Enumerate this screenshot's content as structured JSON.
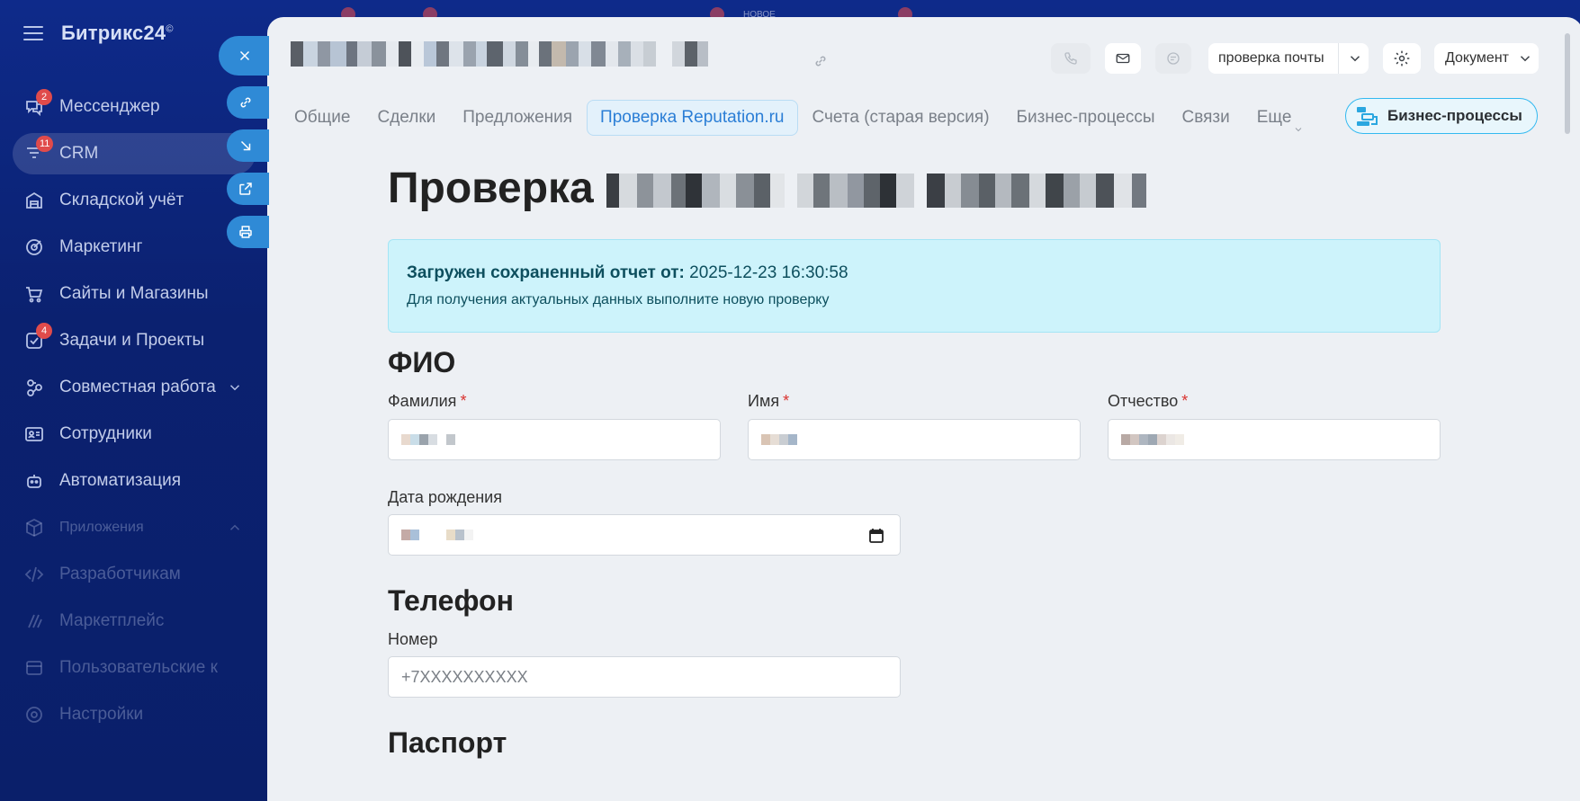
{
  "sidebar": {
    "logo": "Битрикс24",
    "logo_mark": "©",
    "items": [
      {
        "label": "Мессенджер",
        "badge": "2",
        "icon": "messenger-icon"
      },
      {
        "label": "CRM",
        "badge": "11",
        "icon": "crm-funnel-icon"
      },
      {
        "label": "Складской учёт",
        "badge": "",
        "icon": "warehouse-icon"
      },
      {
        "label": "Маркетинг",
        "badge": "",
        "icon": "marketing-icon"
      },
      {
        "label": "Сайты и Магазины",
        "badge": "",
        "icon": "cart-icon"
      },
      {
        "label": "Задачи и Проекты",
        "badge": "4",
        "icon": "tasks-icon"
      },
      {
        "label": "Совместная работа",
        "badge": "",
        "icon": "collaboration-icon"
      },
      {
        "label": "Сотрудники",
        "badge": "",
        "icon": "employees-icon"
      },
      {
        "label": "Автоматизация",
        "badge": "",
        "icon": "automation-icon"
      },
      {
        "label": "Приложения",
        "badge": "",
        "icon": "apps-icon"
      },
      {
        "label": "Разработчикам",
        "badge": "",
        "icon": "code-icon"
      },
      {
        "label": "Маркетплейс",
        "badge": "",
        "icon": "marketplace-icon"
      },
      {
        "label": "Пользовательские к",
        "badge": "",
        "icon": "custom-icon"
      },
      {
        "label": "Настройки",
        "badge": "",
        "icon": "settings-icon"
      }
    ]
  },
  "top_peek": {
    "new_label": "НОВОЕ"
  },
  "header": {
    "check_mail_label": "проверка почты",
    "document_label": "Документ"
  },
  "tabs": [
    {
      "label": "Общие"
    },
    {
      "label": "Сделки"
    },
    {
      "label": "Предложения"
    },
    {
      "label": "Проверка Reputation.ru"
    },
    {
      "label": "Счета (старая версия)"
    },
    {
      "label": "Бизнес-процессы"
    },
    {
      "label": "Связи"
    },
    {
      "label": "Еще"
    }
  ],
  "business_processes_button": "Бизнес-процессы",
  "content": {
    "title_prefix": "Проверка",
    "alert": {
      "bold": "Загружен сохраненный отчет от:",
      "datetime": "2025-12-23 16:30:58",
      "note": "Для получения актуальных данных выполните новую проверку"
    },
    "sections": {
      "fio": "ФИО",
      "phone": "Телефон",
      "passport": "Паспорт"
    },
    "fields": {
      "last_name": "Фамилия",
      "first_name": "Имя",
      "middle_name": "Отчество",
      "birth_date": "Дата рождения",
      "phone_number": "Номер",
      "phone_placeholder": "+7XXXXXXXXXX",
      "required_mark": "*"
    }
  },
  "colors": {
    "sidebar_bg": "#0b2170",
    "panel_bg": "#edf0f4",
    "accent": "#2b7ed6",
    "alert_bg": "#cdf3fb",
    "required": "#d9332f",
    "action_button": "#2f8ad6"
  }
}
